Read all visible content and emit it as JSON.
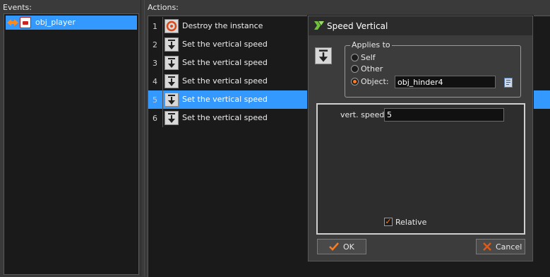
{
  "events": {
    "label": "Events:",
    "items": [
      {
        "name": "obj_player",
        "icon": "collision-event-icon",
        "selected": true
      }
    ]
  },
  "actions": {
    "label": "Actions:",
    "rows": [
      {
        "num": "1",
        "label": "Destroy the instance",
        "icon": "destroy-instance-icon"
      },
      {
        "num": "2",
        "label": "Set the vertical speed",
        "icon": "vertical-speed-icon"
      },
      {
        "num": "3",
        "label": "Set the vertical speed",
        "icon": "vertical-speed-icon"
      },
      {
        "num": "4",
        "label": "Set the vertical speed",
        "icon": "vertical-speed-icon"
      },
      {
        "num": "5",
        "label": "Set the vertical speed",
        "icon": "vertical-speed-icon",
        "selected": true
      },
      {
        "num": "6",
        "label": "Set the vertical speed",
        "icon": "vertical-speed-icon"
      }
    ]
  },
  "dialog": {
    "title": "Speed Vertical",
    "applies_to": {
      "legend": "Applies to",
      "options": [
        "Self",
        "Other",
        "Object:"
      ],
      "selected": "Object:",
      "object_value": "obj_hinder4"
    },
    "params": {
      "speed_label": "vert. speed:",
      "speed_value": "5",
      "relative_label": "Relative",
      "relative_checked": true
    },
    "ok_label": "OK",
    "cancel_label": "Cancel"
  },
  "colors": {
    "selection": "#3399ff",
    "panel_bg": "#1a1a1a",
    "window_bg": "#3a3a3a",
    "accent": "#ff7a1a"
  }
}
